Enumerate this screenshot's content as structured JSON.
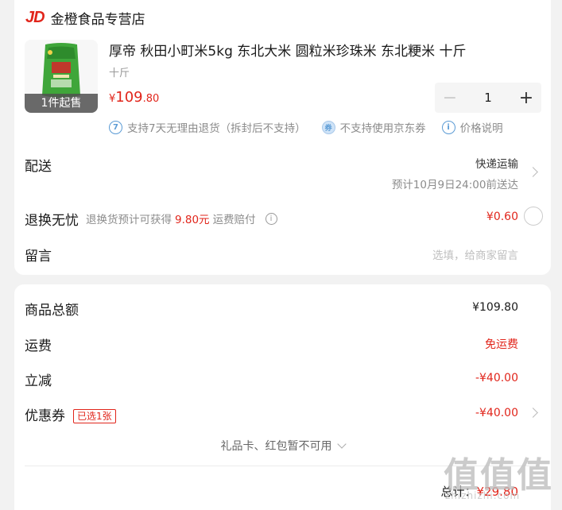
{
  "store": {
    "logo": "JD",
    "name": "金橙食品专营店"
  },
  "product": {
    "title": "厚帝 秋田小町米5kg 东北大米 圆粒米珍珠米 东北粳米 十斤",
    "spec": "十斤",
    "price_currency": "¥",
    "price_int": "109",
    "price_dec": ".80",
    "min_qty_badge": "1件起售",
    "image_name": "rice-bag-image",
    "quantity": "1"
  },
  "tags": [
    {
      "icon": "7",
      "text": "支持7天无理由退货（拆封后不支持）"
    },
    {
      "icon": "券",
      "text": "不支持使用京东券"
    },
    {
      "icon": "i",
      "text": "价格说明"
    }
  ],
  "shipping": {
    "label": "配送",
    "method": "快递运输",
    "eta": "预计10月9日24:00前送达"
  },
  "return_care": {
    "label": "退换无忧",
    "hint_prefix": "退换货预计可获得",
    "hint_amount": "9.80元",
    "hint_suffix": "运费赔付",
    "price": "¥0.60"
  },
  "note": {
    "label": "留言",
    "placeholder": "选填，给商家留言"
  },
  "summary": {
    "goods_total_label": "商品总额",
    "goods_total": "¥109.80",
    "shipping_label": "运费",
    "shipping_value": "免运费",
    "discount_label": "立减",
    "discount_value": "-¥40.00",
    "coupon_label": "优惠券",
    "coupon_badge": "已选1张",
    "coupon_value": "-¥40.00",
    "giftcard_text": "礼品卡、红包暂不可用",
    "total_label": "总计：",
    "total_value": "¥29.80"
  },
  "watermark": {
    "text": "值值值",
    "sub": "zhizhizhi.com"
  },
  "colors": {
    "accent": "#e1251b",
    "muted": "#8c8c8c",
    "info_blue": "#5b9bd5"
  }
}
